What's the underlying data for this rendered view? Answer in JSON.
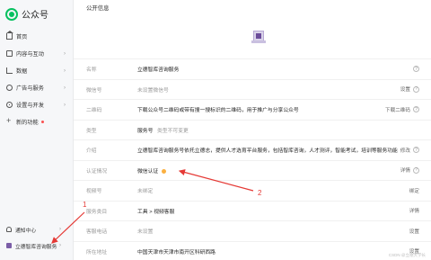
{
  "app": {
    "title": "公众号"
  },
  "sidebar": {
    "items": [
      {
        "label": "首页",
        "icon": "home-icon"
      },
      {
        "label": "内容与互动",
        "icon": "document-icon",
        "chevron": "›"
      },
      {
        "label": "数据",
        "icon": "chart-icon",
        "chevron": "›"
      },
      {
        "label": "广告与服务",
        "icon": "ad-icon",
        "chevron": "›"
      },
      {
        "label": "设置与开发",
        "icon": "gear-icon",
        "chevron": "›"
      },
      {
        "label": "新的功能",
        "icon": "plus-icon",
        "badge_dot": true
      }
    ],
    "bottom": [
      {
        "label": "通知中心",
        "icon": "bell-icon",
        "chevron": "›"
      },
      {
        "label": "立德智库咨询服务",
        "icon": "account-avatar",
        "chevron": "›"
      }
    ]
  },
  "main": {
    "section_title": "公开信息",
    "rows": [
      {
        "label": "名称",
        "value": "立德智库咨询服务",
        "action": "",
        "help": true
      },
      {
        "label": "微信号",
        "value": "未设置微信号",
        "muted": true,
        "action": "设置",
        "help": true
      },
      {
        "label": "二维码",
        "value": "下载公众号二维码或带有搜一搜标识的二维码，用于推广与分享公众号",
        "action": "下载二维码",
        "help": true
      },
      {
        "label": "类型",
        "value": "服务号",
        "value_extra": "类型不可变更",
        "action": "",
        "help": false
      },
      {
        "label": "介绍",
        "value": "立德智库咨询服务号依托立德志，提供人才选育平台服务，包括智库咨询，人才测评，智能考试，培训等服务功能",
        "action": "修改",
        "help": true
      },
      {
        "label": "认证情况",
        "value": "微信认证",
        "verified_dot": true,
        "action": "详情",
        "help": true
      },
      {
        "label": "视频号",
        "value": "未绑定",
        "muted": true,
        "action": "绑定",
        "help": false
      },
      {
        "label": "服务类目",
        "value": "工具 > 视频客服",
        "action": "详情",
        "help": false
      },
      {
        "label": "客服电话",
        "value": "未设置",
        "muted": true,
        "action": "设置",
        "help": false
      },
      {
        "label": "所在地址",
        "value": "中国天津市天津市南开区科研西路",
        "action": "设置",
        "help": false
      }
    ]
  },
  "annotations": [
    {
      "label": "1",
      "color": "#e53935"
    },
    {
      "label": "2",
      "color": "#e53935"
    }
  ],
  "watermark": "CSDN @立德大学长",
  "colors": {
    "brand": "#07c160",
    "annotation": "#e53935",
    "badge": "#fa5151",
    "verified": "#fbb040"
  }
}
